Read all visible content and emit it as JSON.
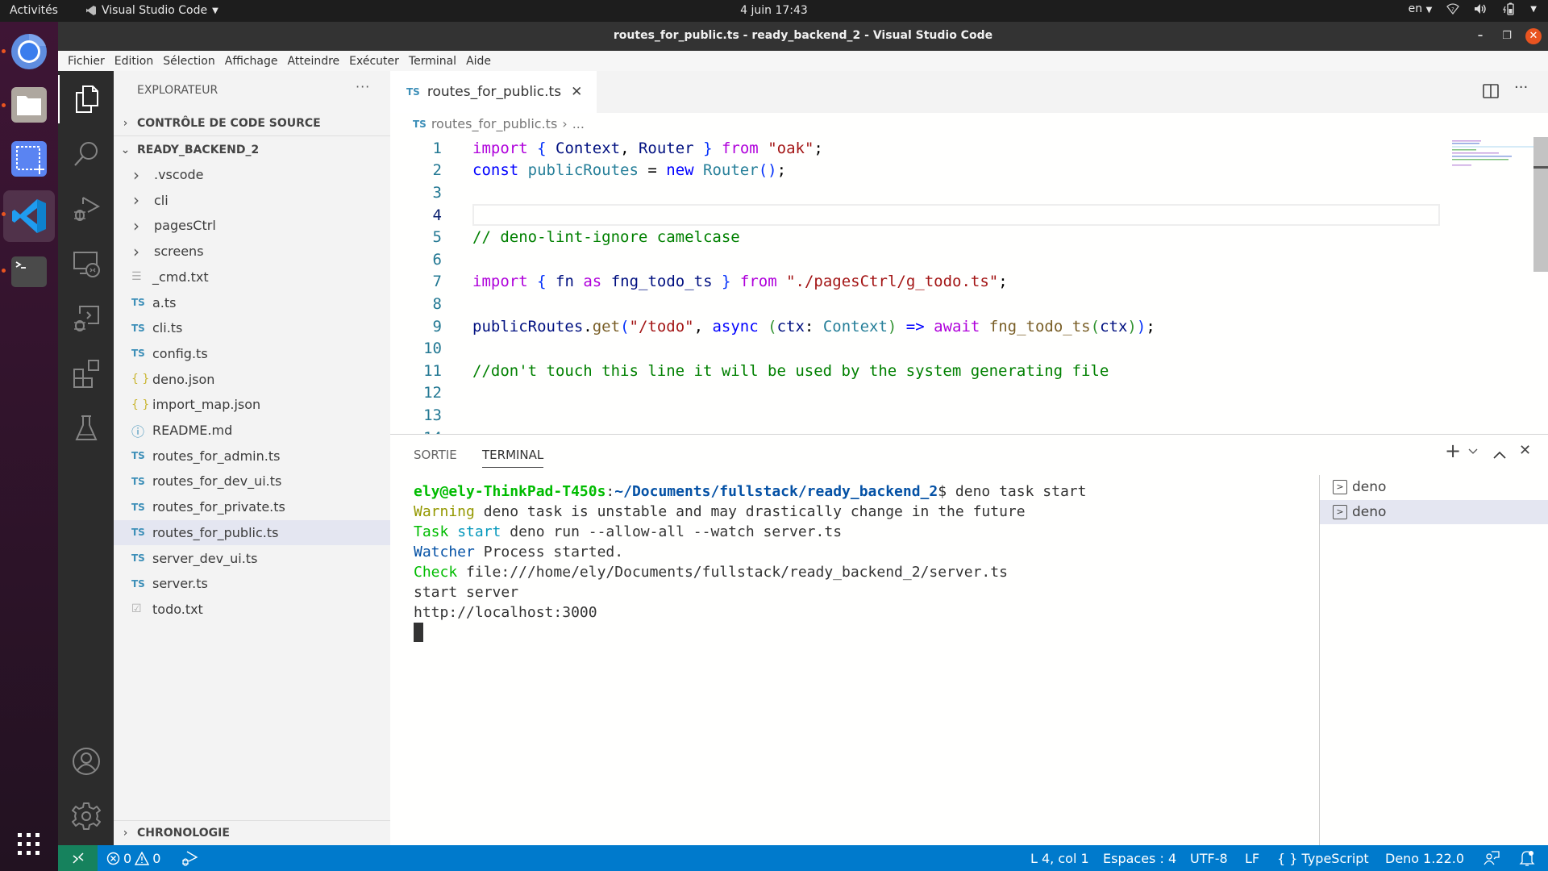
{
  "topbar": {
    "activities": "Activités",
    "app_menu": "Visual Studio Code",
    "clock": "4 juin  17:43",
    "lang": "en"
  },
  "dock": {
    "items": [
      {
        "name": "chrome",
        "running": true
      },
      {
        "name": "files",
        "running": true
      },
      {
        "name": "screenshot",
        "running": false
      },
      {
        "name": "vscode",
        "running": true,
        "active": true
      },
      {
        "name": "terminal",
        "running": true
      }
    ]
  },
  "window": {
    "title": "routes_for_public.ts - ready_backend_2 - Visual Studio Code",
    "minimize": "–",
    "restore": "❐",
    "close": "✕"
  },
  "menubar": [
    "Fichier",
    "Edition",
    "Sélection",
    "Affichage",
    "Atteindre",
    "Exécuter",
    "Terminal",
    "Aide"
  ],
  "sidebar": {
    "title": "EXPLORATEUR",
    "more": "···",
    "sections": {
      "scm": "CONTRÔLE DE CODE SOURCE",
      "project": "READY_BACKEND_2",
      "timeline": "CHRONOLOGIE"
    },
    "items": [
      {
        "label": ".vscode",
        "type": "folder"
      },
      {
        "label": "cli",
        "type": "folder"
      },
      {
        "label": "pagesCtrl",
        "type": "folder"
      },
      {
        "label": "screens",
        "type": "folder"
      },
      {
        "label": "_cmd.txt",
        "type": "text"
      },
      {
        "label": "a.ts",
        "type": "ts"
      },
      {
        "label": "cli.ts",
        "type": "ts"
      },
      {
        "label": "config.ts",
        "type": "ts"
      },
      {
        "label": "deno.json",
        "type": "json"
      },
      {
        "label": "import_map.json",
        "type": "json"
      },
      {
        "label": "README.md",
        "type": "info"
      },
      {
        "label": "routes_for_admin.ts",
        "type": "ts"
      },
      {
        "label": "routes_for_dev_ui.ts",
        "type": "ts"
      },
      {
        "label": "routes_for_private.ts",
        "type": "ts"
      },
      {
        "label": "routes_for_public.ts",
        "type": "ts",
        "selected": true
      },
      {
        "label": "server_dev_ui.ts",
        "type": "ts"
      },
      {
        "label": "server.ts",
        "type": "ts"
      },
      {
        "label": "todo.txt",
        "type": "todo"
      }
    ]
  },
  "editor": {
    "tab": {
      "badge": "TS",
      "label": "routes_for_public.ts",
      "close": "✕"
    },
    "breadcrumb": {
      "badge": "TS",
      "file": "routes_for_public.ts",
      "sep": "›",
      "rest": "..."
    },
    "current_line": 4,
    "lines": [
      [
        [
          "k-import",
          "import"
        ],
        [
          "k-punc",
          " "
        ],
        [
          "k-brace",
          "{"
        ],
        [
          "k-punc",
          " "
        ],
        [
          "k-var",
          "Context"
        ],
        [
          "k-punc",
          ", "
        ],
        [
          "k-var",
          "Router"
        ],
        [
          "k-punc",
          " "
        ],
        [
          "k-brace",
          "}"
        ],
        [
          "k-punc",
          " "
        ],
        [
          "k-import",
          "from"
        ],
        [
          "k-punc",
          " "
        ],
        [
          "k-str",
          "\"oak\""
        ],
        [
          "k-punc",
          ";"
        ]
      ],
      [
        [
          "k-blue",
          "const"
        ],
        [
          "k-punc",
          " "
        ],
        [
          "k-type",
          "publicRoutes"
        ],
        [
          "k-punc",
          " = "
        ],
        [
          "k-blue",
          "new"
        ],
        [
          "k-punc",
          " "
        ],
        [
          "k-type",
          "Router"
        ],
        [
          "k-brace",
          "()"
        ],
        [
          "k-punc",
          ";"
        ]
      ],
      [],
      [],
      [
        [
          "k-com",
          "// deno-lint-ignore camelcase"
        ]
      ],
      [],
      [
        [
          "k-import",
          "import"
        ],
        [
          "k-punc",
          " "
        ],
        [
          "k-brace",
          "{"
        ],
        [
          "k-punc",
          " "
        ],
        [
          "k-var",
          "fn"
        ],
        [
          "k-punc",
          " "
        ],
        [
          "k-import",
          "as"
        ],
        [
          "k-punc",
          " "
        ],
        [
          "k-var",
          "fng_todo_ts"
        ],
        [
          "k-punc",
          " "
        ],
        [
          "k-brace",
          "}"
        ],
        [
          "k-punc",
          " "
        ],
        [
          "k-import",
          "from"
        ],
        [
          "k-punc",
          " "
        ],
        [
          "k-str",
          "\"./pagesCtrl/g_todo.ts\""
        ],
        [
          "k-punc",
          ";"
        ]
      ],
      [],
      [
        [
          "k-var",
          "publicRoutes"
        ],
        [
          "k-punc",
          "."
        ],
        [
          "k-fn",
          "get"
        ],
        [
          "k-brace",
          "("
        ],
        [
          "k-str",
          "\"/todo\""
        ],
        [
          "k-punc",
          ", "
        ],
        [
          "k-blue",
          "async"
        ],
        [
          "k-punc",
          " "
        ],
        [
          "k-paren",
          "("
        ],
        [
          "k-var",
          "ctx"
        ],
        [
          "k-punc",
          ": "
        ],
        [
          "k-type",
          "Context"
        ],
        [
          "k-paren",
          ")"
        ],
        [
          "k-punc",
          " "
        ],
        [
          "k-blue",
          "=>"
        ],
        [
          "k-punc",
          " "
        ],
        [
          "k-import",
          "await"
        ],
        [
          "k-punc",
          " "
        ],
        [
          "k-fn",
          "fng_todo_ts"
        ],
        [
          "k-paren",
          "("
        ],
        [
          "k-var",
          "ctx"
        ],
        [
          "k-paren",
          ")"
        ],
        [
          "k-brace",
          ")"
        ],
        [
          "k-punc",
          ";"
        ]
      ],
      [],
      [
        [
          "k-com",
          "//don't touch this line it will be used by the system generating file"
        ]
      ],
      [],
      [],
      []
    ]
  },
  "panel": {
    "tabs": [
      "SORTIE",
      "TERMINAL"
    ],
    "active_tab": "TERMINAL",
    "controls": {
      "add": "+",
      "dropdown": "⌄",
      "maximize": "^",
      "close": "✕"
    },
    "terminal": {
      "prompt_user": "ely@ely-ThinkPad-T450s",
      "prompt_sep": ":",
      "prompt_path": "~/Documents/fullstack/ready_backend_2",
      "prompt_cmd": "$ deno task start",
      "lines": [
        {
          "tag": "Warning",
          "tag_class": "t-yellow",
          "text": " deno task is unstable and may drastically change in the future"
        },
        {
          "tag": "Task",
          "tag_class": "t-lgreen",
          "tag2": " start",
          "tag2_class": "t-teal",
          "text": " deno run --allow-all --watch server.ts"
        },
        {
          "tag": "Watcher",
          "tag_class": "t-navy",
          "text": " Process started."
        },
        {
          "tag": "Check",
          "tag_class": "t-lgreen",
          "text": " file:///home/ely/Documents/fullstack/ready_backend_2/server.ts"
        },
        {
          "tag": "",
          "tag_class": "",
          "text": "start server"
        },
        {
          "tag": "",
          "tag_class": "",
          "text": "http://localhost:3000"
        }
      ]
    },
    "terminal_list": [
      {
        "label": "deno",
        "selected": false
      },
      {
        "label": "deno",
        "selected": true
      }
    ]
  },
  "statusbar": {
    "errors": "0",
    "warnings": "0",
    "position": "L 4, col 1",
    "indent": "Espaces : 4",
    "encoding": "UTF-8",
    "eol": "LF",
    "language": "TypeScript",
    "runtime": "Deno 1.22.0"
  },
  "colors": {
    "statusbar": "#007acc",
    "remote": "#16825d",
    "accent_orange": "#e95420"
  }
}
